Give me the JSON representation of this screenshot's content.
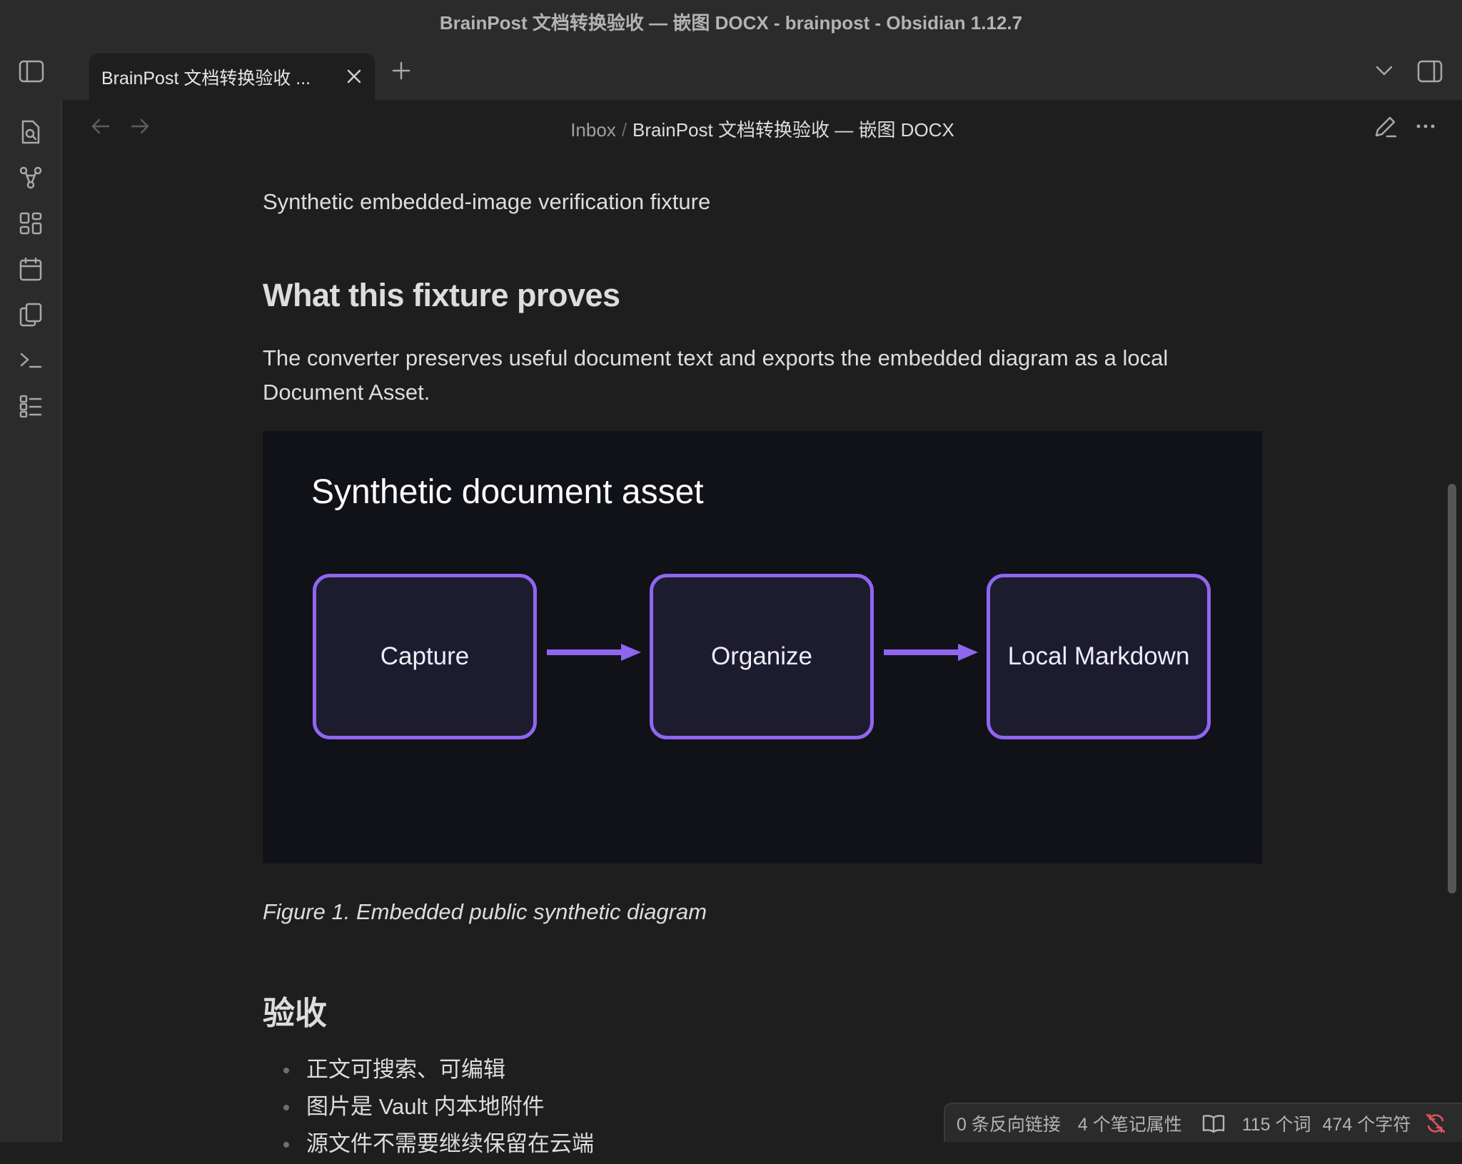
{
  "window": {
    "title": "BrainPost 文档转换验收 — 嵌图 DOCX - brainpost - Obsidian 1.12.7"
  },
  "tabs": [
    {
      "label": "BrainPost 文档转换验收 ...",
      "active": true
    }
  ],
  "breadcrumb": {
    "parent": "Inbox",
    "separator": "/",
    "current": "BrainPost 文档转换验收 — 嵌图 DOCX"
  },
  "ribbon_icons": [
    "search-icon",
    "graph-view-icon",
    "canvas-icon",
    "calendar-icon",
    "copy-icon",
    "terminal-icon",
    "list-icon"
  ],
  "document": {
    "subtitle": "Synthetic embedded-image verification fixture",
    "heading1": "What this fixture proves",
    "paragraph": "The converter preserves useful document text and exports the embedded diagram as a local Document Asset.",
    "figure": {
      "title": "Synthetic document asset",
      "nodes": [
        "Capture",
        "Organize",
        "Local Markdown"
      ],
      "caption": "Figure 1. Embedded public synthetic diagram"
    },
    "heading2": "验收",
    "list": [
      "正文可搜索、可编辑",
      "图片是 Vault 内本地附件",
      "源文件不需要继续保留在云端"
    ]
  },
  "status": {
    "backlinks": "0 条反向链接",
    "properties": "4 个笔记属性",
    "words": "115 个词",
    "chars": "474 个字符"
  },
  "colors": {
    "accent": "#8f66f0",
    "background": "#1e1e1e",
    "chrome": "#2b2b2b",
    "sync_error": "#e05561"
  }
}
